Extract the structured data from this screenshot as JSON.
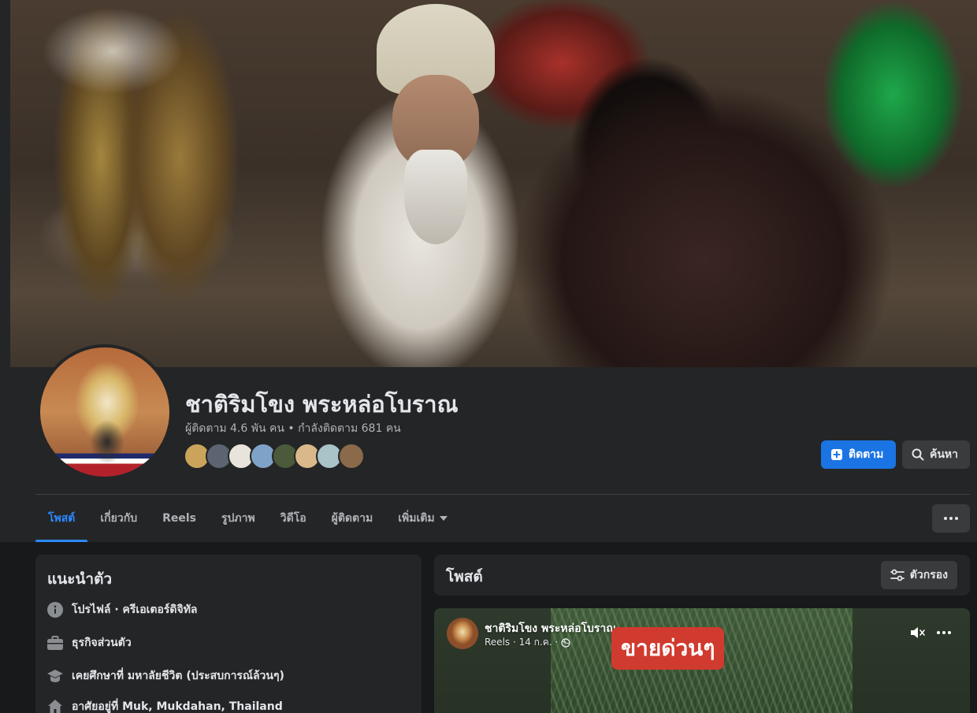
{
  "profile": {
    "name": "ชาติริมโขง พระหล่อโบราณ",
    "stats": "ผู้ติดตาม 4.6 พัน คน • กำลังติดตาม 681 คน",
    "follower_avatars": [
      "#c9a45a",
      "#5b6470",
      "#e8e4dc",
      "#7fa3c8",
      "#4a5a3a",
      "#d9b88a",
      "#a9c3c8",
      "#8a6a4a"
    ]
  },
  "actions": {
    "follow_label": "ติดตาม",
    "search_label": "ค้นหา"
  },
  "tabs": [
    {
      "label": "โพสต์"
    },
    {
      "label": "เกี่ยวกับ"
    },
    {
      "label": "Reels"
    },
    {
      "label": "รูปภาพ"
    },
    {
      "label": "วิดีโอ"
    },
    {
      "label": "ผู้ติดตาม"
    },
    {
      "label": "เพิ่มเติม"
    }
  ],
  "intro": {
    "title": "แนะนำตัว",
    "rows": [
      {
        "text": "โปรไฟล์ · ครีเอเตอร์ดิจิทัล",
        "icon": "info-icon"
      },
      {
        "text": "ธุรกิจส่วนตัว",
        "icon": "briefcase-icon"
      },
      {
        "text": "เคยศึกษาที่ มหาลัยชีวิต (ประสบการณ์ล้วนๆ)",
        "icon": "graduation-cap-icon"
      },
      {
        "text": "อาศัยอยู่ที่ Muk, Mukdahan, Thailand",
        "icon": "home-icon"
      }
    ]
  },
  "posts": {
    "title": "โพสต์",
    "filter_label": "ตัวกรอง"
  },
  "reel": {
    "author": "ชาติริมโขง พระหล่อโบราณ",
    "meta": "Reels · 14 ก.ค. ·",
    "overlay_text": "ขายด่วนๆ"
  },
  "colors": {
    "accent": "#2d88ff",
    "primary_button": "#1b74e4",
    "overlay_banner": "#d13a2e"
  }
}
